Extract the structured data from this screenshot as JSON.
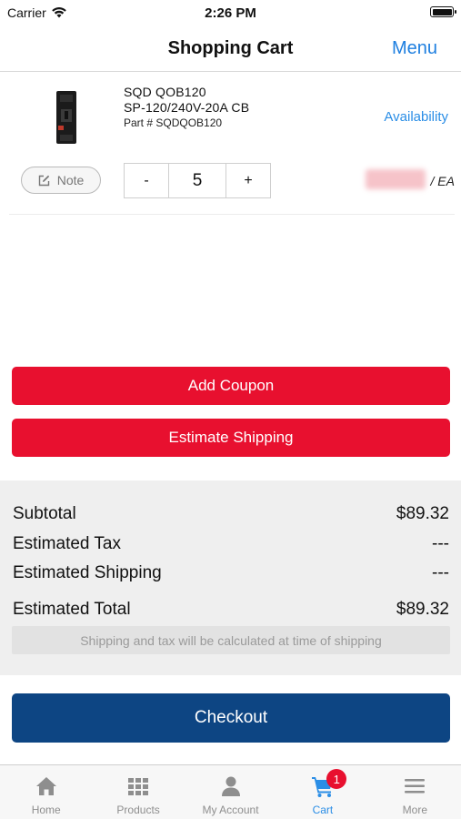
{
  "status_bar": {
    "carrier": "Carrier",
    "time": "2:26 PM"
  },
  "nav": {
    "title": "Shopping Cart",
    "menu_label": "Menu"
  },
  "cart_item": {
    "name_line1": "SQD QOB120",
    "name_line2": "SP-120/240V-20A CB",
    "part_number": "Part # SQDQOB120",
    "availability_label": "Availability",
    "note_label": "Note",
    "minus_label": "-",
    "quantity": "5",
    "plus_label": "+",
    "unit": "/ EA"
  },
  "actions": {
    "add_coupon": "Add Coupon",
    "estimate_shipping": "Estimate Shipping"
  },
  "summary": {
    "subtotal_label": "Subtotal",
    "subtotal_value": "$89.32",
    "tax_label": "Estimated Tax",
    "tax_value": "---",
    "shipping_label": "Estimated Shipping",
    "shipping_value": "---",
    "total_label": "Estimated Total",
    "total_value": "$89.32",
    "notice": "Shipping and tax will be calculated at time of shipping"
  },
  "checkout_label": "Checkout",
  "tab_bar": {
    "items": [
      {
        "label": "Home",
        "icon": "home-icon"
      },
      {
        "label": "Products",
        "icon": "grid-icon"
      },
      {
        "label": "My Account",
        "icon": "person-icon"
      },
      {
        "label": "Cart",
        "icon": "cart-icon",
        "badge": "1"
      },
      {
        "label": "More",
        "icon": "menu-icon"
      }
    ]
  },
  "colors": {
    "accent_blue": "#2b8ee6",
    "action_red": "#e8102f",
    "checkout_navy": "#0d4583"
  }
}
